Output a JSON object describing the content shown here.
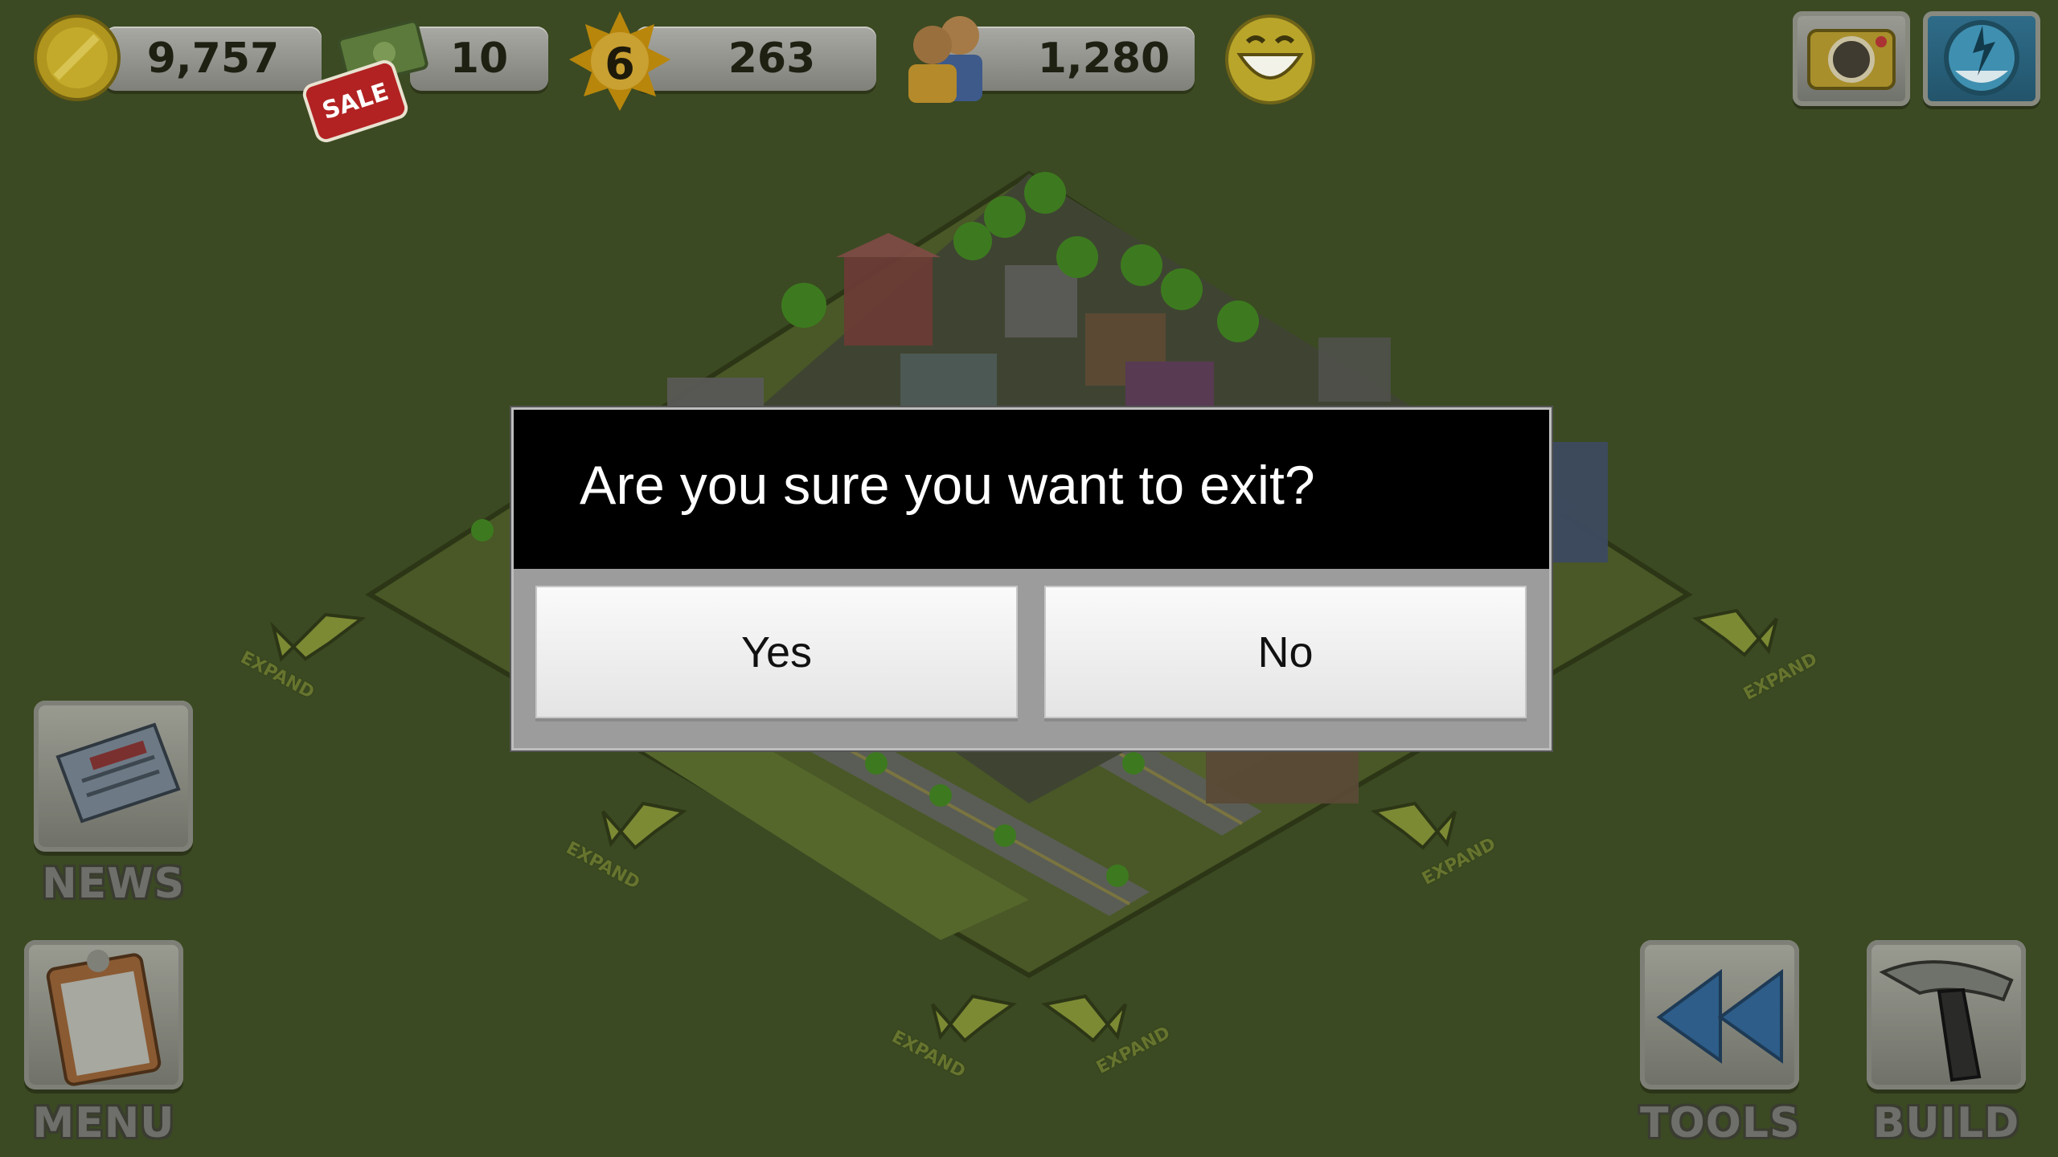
{
  "hud": {
    "coins": "9,757",
    "cash": "10",
    "sale_tag": "SALE",
    "level": "6",
    "xp": "263",
    "population": "1,280"
  },
  "dialog": {
    "message": "Are you sure you want to exit?",
    "yes_label": "Yes",
    "no_label": "No"
  },
  "buttons": {
    "news": "NEWS",
    "menu": "MENU",
    "tools": "TOOLS",
    "build": "BUILD"
  },
  "expand_labels": {
    "left_upper": "EXPAND",
    "left_mid": "EXPAND",
    "bottom_left": "EXPAND",
    "bottom_right": "EXPAND",
    "right_mid": "EXPAND",
    "right_upper": "EXPAND"
  },
  "colors": {
    "background": "#3b4a22",
    "dialog_header": "#000000",
    "dialog_body": "#9c9c9c",
    "button_face": "#f2f2f2"
  }
}
